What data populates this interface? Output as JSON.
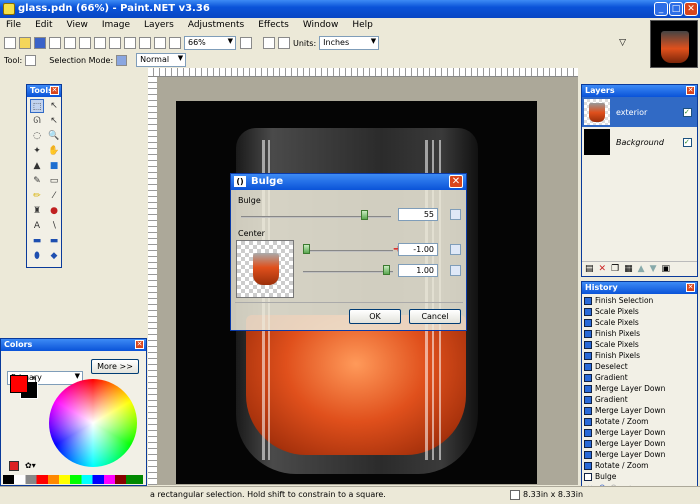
{
  "window": {
    "title": "glass.pdn (66%) - Paint.NET v3.36"
  },
  "menu": [
    "File",
    "Edit",
    "View",
    "Image",
    "Layers",
    "Adjustments",
    "Effects",
    "Window",
    "Help"
  ],
  "toolbar": {
    "zoom": "66%",
    "units_label": "Units:",
    "units": "Inches",
    "tool_label": "Tool:",
    "selection_mode_label": "Selection Mode:",
    "blend_mode": "Normal"
  },
  "tools": {
    "title": "Tools"
  },
  "layers": {
    "title": "Layers",
    "items": [
      {
        "name": "exterior",
        "checked": true
      },
      {
        "name": "Background",
        "checked": true
      }
    ]
  },
  "history": {
    "title": "History",
    "items": [
      "Finish Selection",
      "Scale Pixels",
      "Scale Pixels",
      "Finish Pixels",
      "Scale Pixels",
      "Finish Pixels",
      "Deselect",
      "Gradient",
      "Merge Layer Down",
      "Gradient",
      "Merge Layer Down",
      "Rotate / Zoom",
      "Merge Layer Down",
      "Merge Layer Down",
      "Merge Layer Down",
      "Rotate / Zoom",
      "Bulge"
    ]
  },
  "colors": {
    "title": "Colors",
    "mode": "Primary",
    "more_button": "More >>",
    "primary": "#ff0000",
    "secondary": "#000000"
  },
  "dialog": {
    "title": "Bulge",
    "bulge_label": "Bulge",
    "bulge_value": "55",
    "center_label": "Center",
    "center_x": "-1.00",
    "center_y": "1.00",
    "ok": "OK",
    "cancel": "Cancel"
  },
  "status": {
    "hint": "a rectangular selection. Hold shift to constrain to a square.",
    "size": "8.33in x 8.33in"
  }
}
